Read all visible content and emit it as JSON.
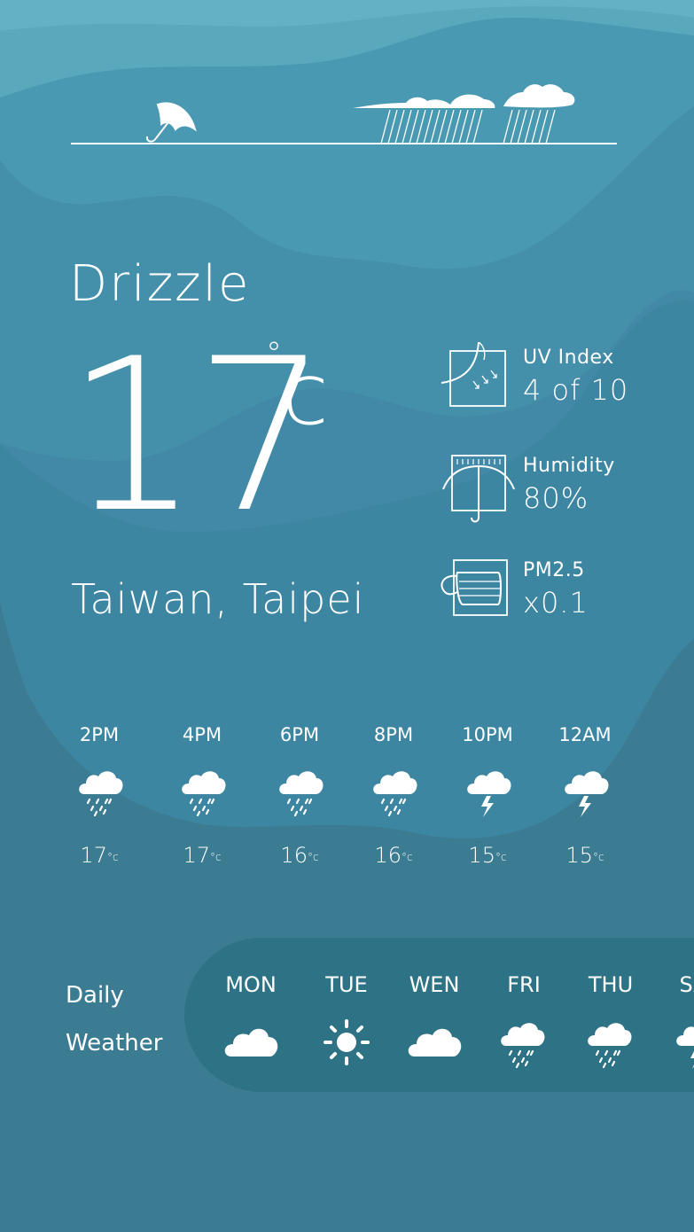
{
  "current": {
    "condition": "Drizzle",
    "temperature": "17",
    "degree_symbol": "°",
    "unit": "c",
    "location": "Taiwan, Taipei"
  },
  "stats": [
    {
      "label": "UV Index",
      "value": "4 of 10",
      "icon": "uv-index-icon"
    },
    {
      "label": "Humidity",
      "value": "80%",
      "icon": "humidity-umbrella-icon"
    },
    {
      "label": "PM2.5",
      "value": "x0.1",
      "icon": "face-mask-icon"
    }
  ],
  "hourly": [
    {
      "time": "2PM",
      "temp": "17",
      "unit": "°c",
      "icon": "rain-cloud-icon"
    },
    {
      "time": "4PM",
      "temp": "17",
      "unit": "°c",
      "icon": "rain-cloud-icon"
    },
    {
      "time": "6PM",
      "temp": "16",
      "unit": "°c",
      "icon": "rain-cloud-icon"
    },
    {
      "time": "8PM",
      "temp": "16",
      "unit": "°c",
      "icon": "rain-cloud-icon"
    },
    {
      "time": "10PM",
      "temp": "15",
      "unit": "°c",
      "icon": "thunder-cloud-icon"
    },
    {
      "time": "12AM",
      "temp": "15",
      "unit": "°c",
      "icon": "thunder-cloud-icon"
    }
  ],
  "daily": {
    "title_line1": "Daily",
    "title_line2": "Weather",
    "days": [
      {
        "name": "MON",
        "icon": "cloud-icon"
      },
      {
        "name": "TUE",
        "icon": "sun-icon"
      },
      {
        "name": "WEN",
        "icon": "cloud-icon"
      },
      {
        "name": "FRI",
        "icon": "rain-cloud-icon"
      },
      {
        "name": "THU",
        "icon": "rain-cloud-icon"
      },
      {
        "name": "SAT",
        "icon": "thunder-cloud-icon"
      }
    ]
  },
  "colors": {
    "background_top": "#65b3c3",
    "background_mid": "#4c97b0",
    "background_bottom": "#3d7f98",
    "daily_panel": "#2e7385",
    "text": "#ffffff"
  }
}
